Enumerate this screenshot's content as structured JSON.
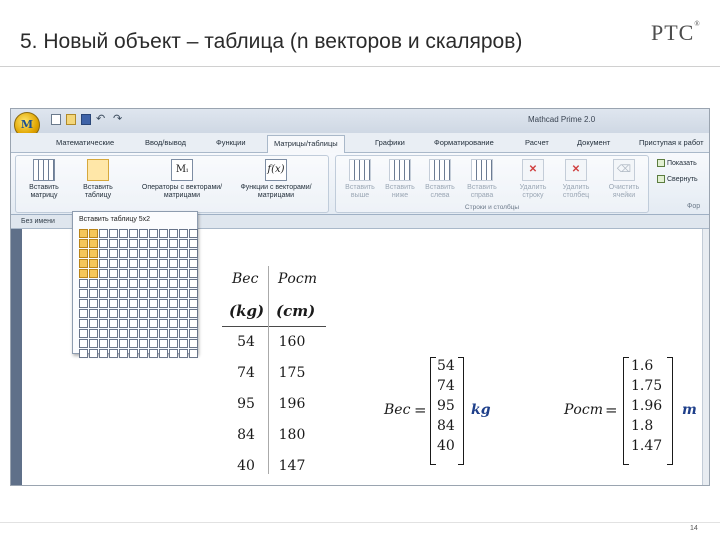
{
  "slide": {
    "title": "5. Новый объект – таблица (n векторов и скаляров)",
    "logo": "PTC",
    "logo_mark": "®",
    "page_number": "14"
  },
  "app": {
    "window_title": "Mathcad Prime 2.0",
    "orb_label": "M",
    "tabs": [
      {
        "label": "Математические",
        "active": false
      },
      {
        "label": "Ввод/вывод",
        "active": false
      },
      {
        "label": "Функции",
        "active": false
      },
      {
        "label": "Матрицы/таблицы",
        "active": true
      },
      {
        "label": "Графики",
        "active": false
      },
      {
        "label": "Форматирование",
        "active": false
      },
      {
        "label": "Расчет",
        "active": false
      },
      {
        "label": "Документ",
        "active": false
      },
      {
        "label": "Приступая к работ",
        "active": false
      }
    ],
    "ribbon": {
      "insert_matrix": "Вставить матрицу",
      "insert_table": "Вставить таблицу",
      "vector_operators": "Операторы с векторами/матрицами",
      "vector_functions": "Функции с векторами/ матрицами",
      "operators_icon_text": "Mᵢ",
      "functions_icon_text": "f(x)",
      "insert_above": "Вставить выше",
      "insert_below": "Вставить ниже",
      "insert_left": "Вставить слева",
      "insert_right": "Вставить справа",
      "delete_row": "Удалить строку",
      "delete_column": "Удалить столбец",
      "clear_cells": "Очистить ячейки",
      "group_rows_columns": "Строки и столбцы",
      "show_label": "Показать",
      "collapse_label": "Свернуть",
      "format_group": "Фор"
    },
    "doc_tab": "Без имени",
    "popup": {
      "title": "Вставить таблицу 5x2",
      "columns": 12,
      "rows": 13,
      "highlight_rows": 5,
      "highlight_cols": 2
    }
  },
  "table": {
    "headers": [
      "Вес",
      "Рост"
    ],
    "units": [
      "(kg)",
      "(cm)"
    ],
    "rows": [
      [
        "54",
        "160"
      ],
      [
        "74",
        "175"
      ],
      [
        "95",
        "196"
      ],
      [
        "84",
        "180"
      ],
      [
        "40",
        "147"
      ]
    ]
  },
  "vectors": {
    "weight": {
      "name": "Вес",
      "equals": "=",
      "values": [
        "54",
        "74",
        "95",
        "84",
        "40"
      ],
      "unit": "kg"
    },
    "height": {
      "name": "Рост",
      "equals": "=",
      "values": [
        "1.6",
        "1.75",
        "1.96",
        "1.8",
        "1.47"
      ],
      "unit": "m"
    }
  }
}
